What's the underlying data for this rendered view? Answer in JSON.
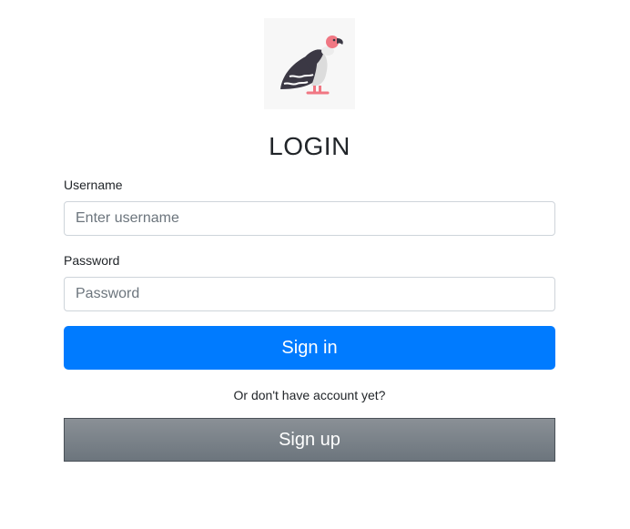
{
  "logo": {
    "icon": "vulture-logo"
  },
  "title": "LOGIN",
  "form": {
    "username_label": "Username",
    "username_placeholder": "Enter username",
    "username_value": "",
    "password_label": "Password",
    "password_placeholder": "Password",
    "password_value": "",
    "signin_label": "Sign in",
    "signup_hint": "Or don't have account yet?",
    "signup_label": "Sign up"
  },
  "colors": {
    "primary": "#007bff",
    "secondary": "#6c757d",
    "input_border": "#ced4da"
  }
}
